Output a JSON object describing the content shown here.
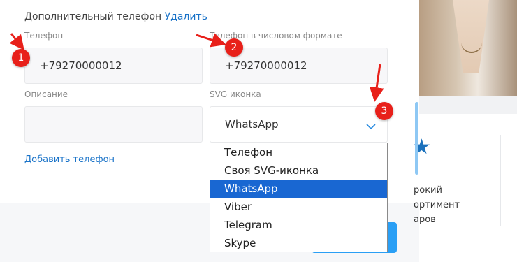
{
  "section": {
    "title": "Дополнительный телефон",
    "delete_link": "Удалить"
  },
  "phone": {
    "label": "Телефон",
    "value": "+79270000012"
  },
  "phone_numeric": {
    "label": "Телефон в числовом формате",
    "value": "+79270000012"
  },
  "description": {
    "label": "Описание",
    "value": ""
  },
  "svg_icon": {
    "label": "SVG иконка",
    "selected": "WhatsApp",
    "options": [
      "Телефон",
      "Своя SVG-иконка",
      "WhatsApp",
      "Viber",
      "Telegram",
      "Skype"
    ]
  },
  "add_phone_link": "Добавить телефон",
  "badges": [
    "1",
    "2",
    "3"
  ],
  "side_promo": {
    "line1": "рокий",
    "line2": "ортимент",
    "line3": "аров"
  },
  "colors": {
    "accent": "#1a73c8",
    "selected_option": "#1967d2",
    "badge": "#e8201a",
    "primary_button": "#2a9ff5"
  }
}
